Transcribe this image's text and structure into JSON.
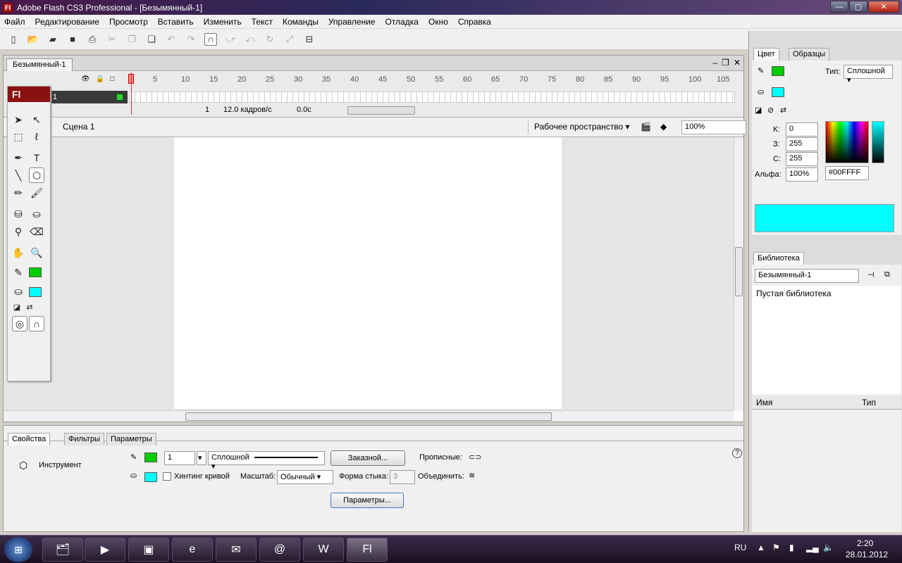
{
  "window": {
    "title": "Adobe Flash CS3 Professional - [Безымянный-1]",
    "app_icon": "Fl",
    "minimize": "—",
    "maximize": "▢",
    "close": "✕"
  },
  "menu": [
    "Файл",
    "Редактирование",
    "Просмотр",
    "Вставить",
    "Изменить",
    "Текст",
    "Команды",
    "Управление",
    "Отладка",
    "Окно",
    "Справка"
  ],
  "document": {
    "tab": "Безымянный-1",
    "timeline": {
      "ruler": [
        "1",
        "5",
        "10",
        "15",
        "20",
        "25",
        "30",
        "35",
        "40",
        "45",
        "50",
        "55",
        "60",
        "65",
        "70",
        "75",
        "80",
        "85",
        "90",
        "95",
        "100",
        "105"
      ],
      "layer_name": "1",
      "current_frame": "1",
      "fps": "12.0 кадров/с",
      "elapsed": "0.0с"
    },
    "scene": "Сцена 1",
    "workspace": "Рабочее пространство ▾",
    "zoom": "100%"
  },
  "tools": {
    "logo": "Fl",
    "stroke_color": "#00cc00",
    "fill_color": "#00ffff"
  },
  "properties": {
    "tabs": [
      "Свойства",
      "Фильтры",
      "Параметры"
    ],
    "tool_label": "Инструмент",
    "stroke_width": "1",
    "stroke_style": "Сплошной",
    "custom_button": "Заказной...",
    "caps_label": "Прописные:",
    "hinting": "Хинтинг кривой",
    "scale_label": "Масштаб:",
    "scale_value": "Обычный",
    "join_label": "Форма стыка:",
    "join_value": "3",
    "merge_label": "Объединить:",
    "params_button": "Параметры..."
  },
  "color_panel": {
    "tabs": [
      "Цвет",
      "Образцы"
    ],
    "type_label": "Тип:",
    "type_value": "Сплошной",
    "r_label": "К:",
    "r_value": "0",
    "g_label": "З:",
    "g_value": "255",
    "b_label": "С:",
    "b_value": "255",
    "alpha_label": "Альфа:",
    "alpha_value": "100%",
    "hex": "#00FFFF",
    "preview_color": "#00ffff"
  },
  "library_panel": {
    "tab": "Библиотека",
    "document": "Безымянный-1",
    "empty_text": "Пустая библиотека",
    "col_name": "Имя",
    "col_type": "Тип"
  },
  "taskbar": {
    "lang": "RU",
    "time": "2:20",
    "date": "28.01.2012",
    "apps": [
      "explorer",
      "media-player",
      "powerpoint",
      "internet-explorer",
      "outlook",
      "mail-agent",
      "word",
      "flash"
    ]
  }
}
